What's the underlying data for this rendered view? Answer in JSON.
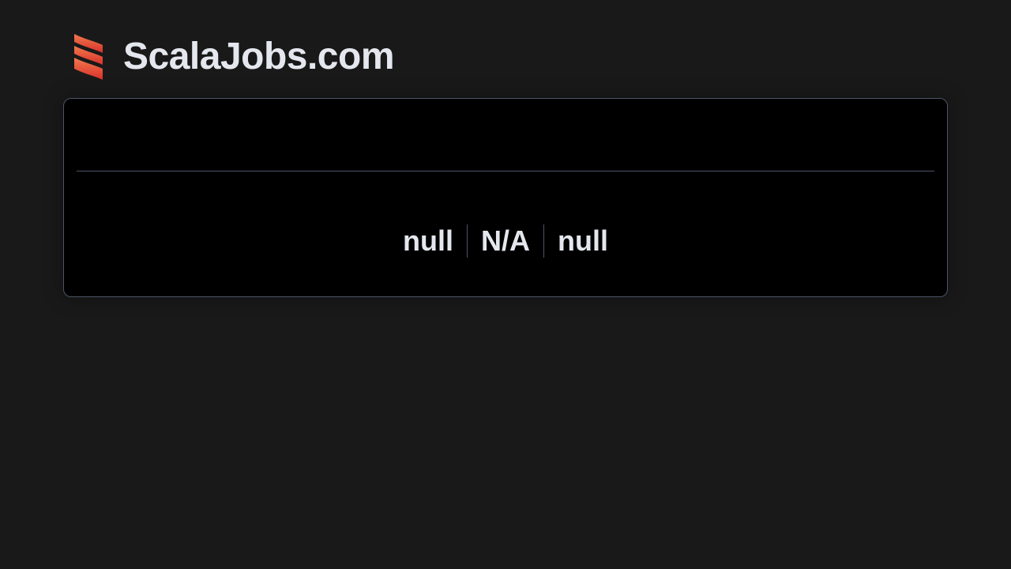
{
  "header": {
    "logo_icon": "scala-logo-icon",
    "brand": "ScalaJobs.com"
  },
  "job_card": {
    "title": "",
    "meta": [
      "null",
      "N/A",
      "null"
    ]
  },
  "colors": {
    "background": "#191919",
    "card_background": "#000000",
    "border": "#4b5566",
    "text": "#e4e7ee",
    "logo_gradient_start": "#f0704a",
    "logo_gradient_end": "#d9302a"
  }
}
